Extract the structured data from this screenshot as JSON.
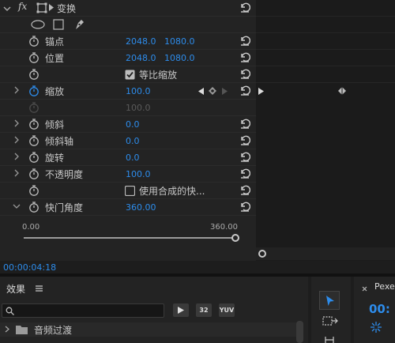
{
  "effect_controls": {
    "fx_label": "fx",
    "group_title": "变换",
    "properties": [
      {
        "label": "锚点",
        "v1": "2048.0",
        "v2": "1080.0"
      },
      {
        "label": "位置",
        "v1": "2048.0",
        "v2": "1080.0"
      },
      {
        "label": "等比缩放",
        "checked": true
      },
      {
        "label": "缩放",
        "v1": "100.0"
      },
      {
        "v1": "100.0"
      },
      {
        "label": "倾斜",
        "v1": "0.0"
      },
      {
        "label": "倾斜轴",
        "v1": "0.0"
      },
      {
        "label": "旋转",
        "v1": "0.0"
      },
      {
        "label": "不透明度",
        "v1": "100.0"
      },
      {
        "label": "使用合成的快...",
        "checked": false
      },
      {
        "label": "快门角度",
        "v1": "360.00"
      }
    ],
    "slider": {
      "min_label": "0.00",
      "max_label": "360.00",
      "value": 360,
      "max": 360
    },
    "timecode": "00:00:04:18"
  },
  "effects_panel": {
    "title": "效果",
    "menu_icon": "hamburger-icon",
    "badges": [
      "32",
      "YUV"
    ],
    "tree_items": [
      "音频过渡"
    ]
  },
  "program_panel": {
    "tab_label": "Pexe",
    "timecode": "00:"
  },
  "colors": {
    "accent_blue": "#2d8ceb",
    "panel_bg": "#232323",
    "text": "#c8c8c8"
  }
}
